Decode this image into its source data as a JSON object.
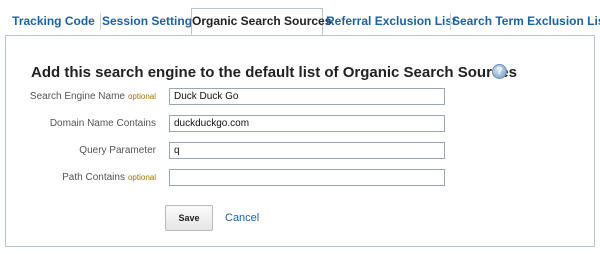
{
  "tabs": [
    {
      "label": "Tracking Code",
      "active": false
    },
    {
      "label": "Session Settings",
      "active": false
    },
    {
      "label": "Organic Search Sources",
      "active": true
    },
    {
      "label": "Referral Exclusion List",
      "active": false
    },
    {
      "label": "Search Term Exclusion List",
      "active": false
    }
  ],
  "form": {
    "heading": "Add this search engine to the default list of Organic Search Sources",
    "help_icon_glyph": "?",
    "optional_label": "optional",
    "fields": {
      "search_engine_name": {
        "label": "Search Engine Name",
        "optional": true,
        "value": "Duck Duck Go"
      },
      "domain_name_contains": {
        "label": "Domain Name Contains",
        "optional": false,
        "value": "duckduckgo.com"
      },
      "query_parameter": {
        "label": "Query Parameter",
        "optional": false,
        "value": "q"
      },
      "path_contains": {
        "label": "Path Contains",
        "optional": true,
        "value": ""
      }
    },
    "save_label": "Save",
    "cancel_label": "Cancel"
  },
  "colors": {
    "link": "#1a62a8",
    "optional": "#a0720a",
    "border": "#b8c3cc"
  }
}
